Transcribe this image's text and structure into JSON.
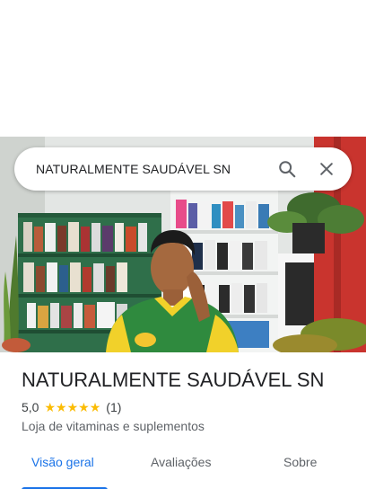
{
  "search": {
    "query": "NATURALMENTE SAUDÁVEL SN",
    "search_icon": "search-icon",
    "close_icon": "close-icon"
  },
  "photo": {
    "description_icon": "storefront-photo"
  },
  "place": {
    "name": "NATURALMENTE SAUDÁVEL SN",
    "rating": "5,0",
    "stars": 5,
    "review_count": "(1)",
    "category": "Loja de vitaminas e suplementos"
  },
  "tabs": [
    {
      "label": "Visão geral",
      "active": true
    },
    {
      "label": "Avaliações",
      "active": false
    },
    {
      "label": "Sobre",
      "active": false
    }
  ],
  "colors": {
    "accent": "#1a73e8",
    "star": "#fbbc04",
    "text_primary": "#202124",
    "text_secondary": "#5f6368"
  }
}
